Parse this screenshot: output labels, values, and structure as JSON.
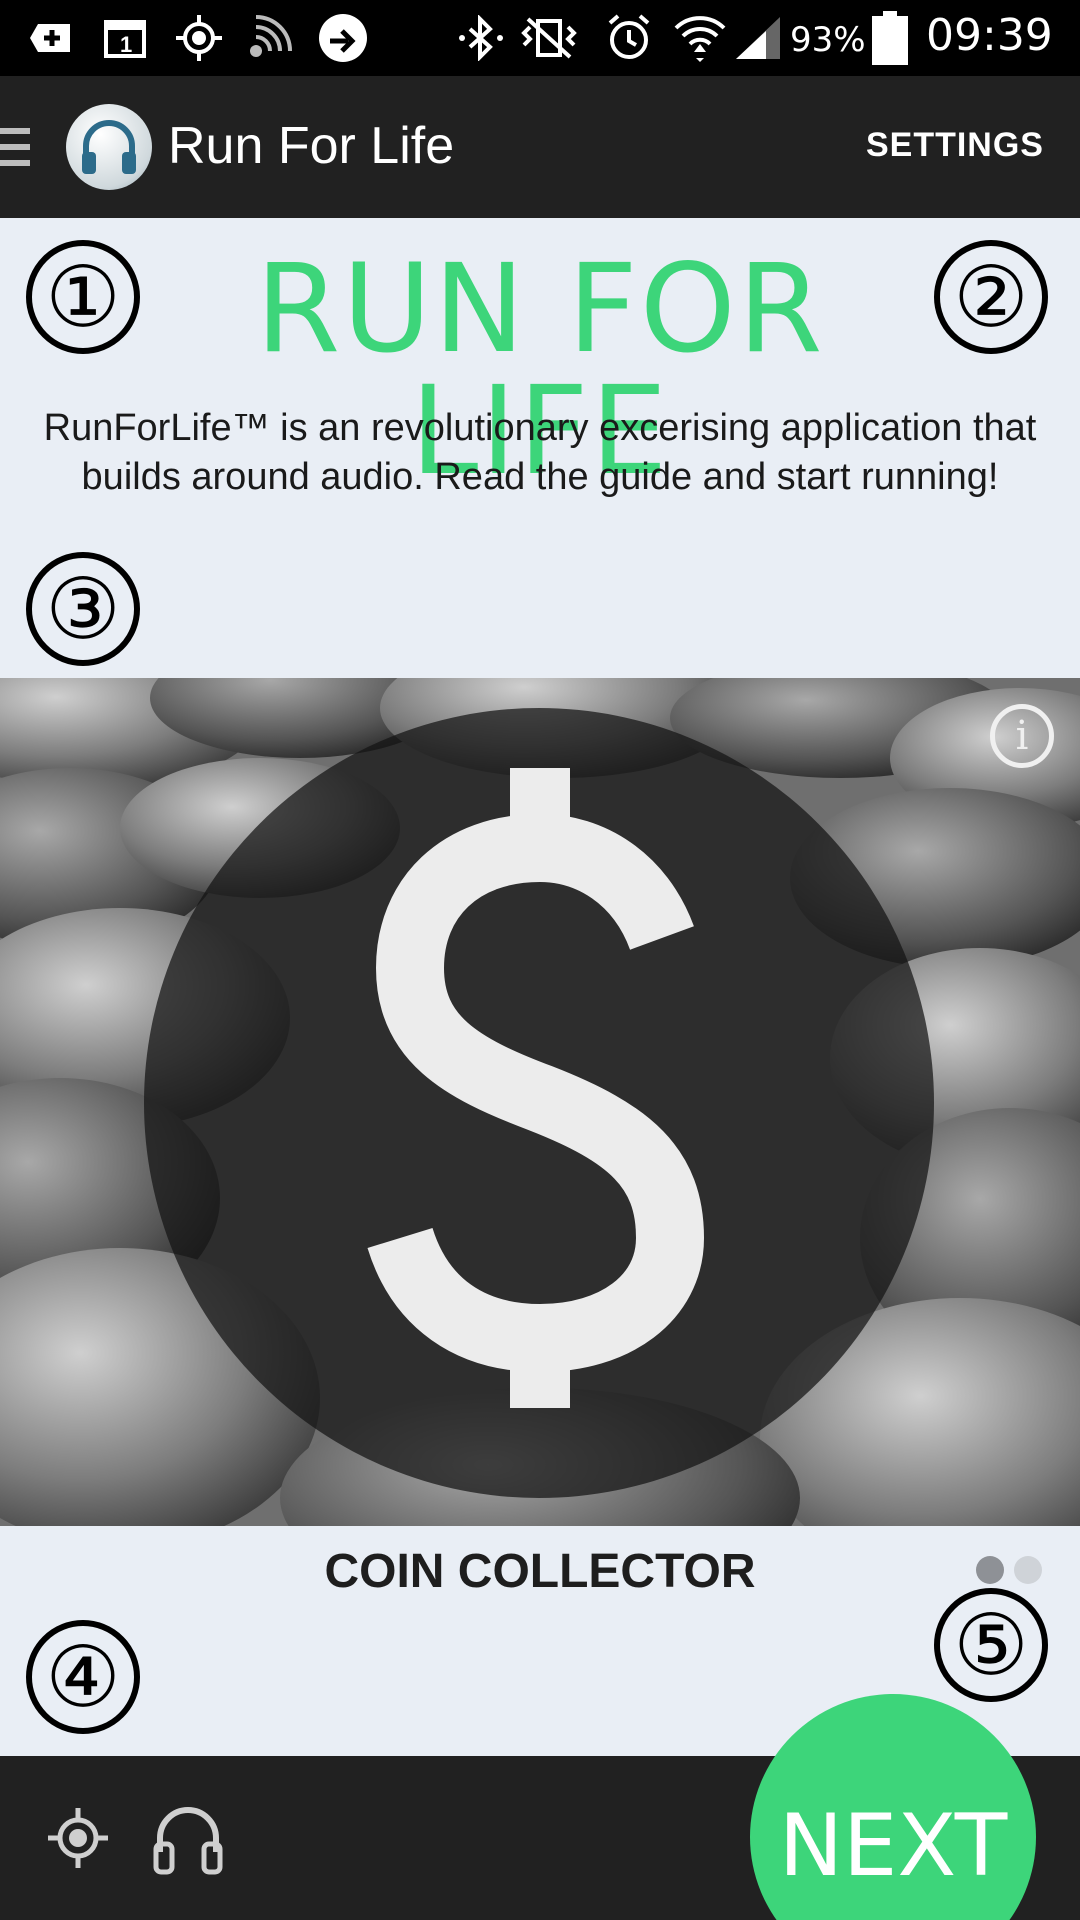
{
  "status_bar": {
    "battery_percent": "93%",
    "time": "09:39",
    "icons": [
      "add-box-icon",
      "calendar-1-icon",
      "gps-icon",
      "signal-stream-icon",
      "arrow-icon",
      "bluetooth-icon",
      "vibrate-icon",
      "alarm-icon",
      "wifi-icon",
      "cellular-icon",
      "battery-icon"
    ]
  },
  "app_bar": {
    "title": "Run For Life",
    "settings_label": "SETTINGS"
  },
  "header": {
    "hero_title": "RUN FOR LIFE",
    "description": "RunForLife™ is an revolutionary excerising application that builds around audio. Read the guide and start running!"
  },
  "annotations": [
    "①",
    "②",
    "③",
    "④",
    "⑤"
  ],
  "card": {
    "title": "COIN COLLECTOR",
    "info_glyph": "i",
    "page_count": 2,
    "active_page": 1
  },
  "bottom_bar": {
    "next_label": "NEXT"
  },
  "colors": {
    "accent_green": "#3dd57a",
    "bar_dark": "#212121",
    "background": "#e9eef5"
  }
}
